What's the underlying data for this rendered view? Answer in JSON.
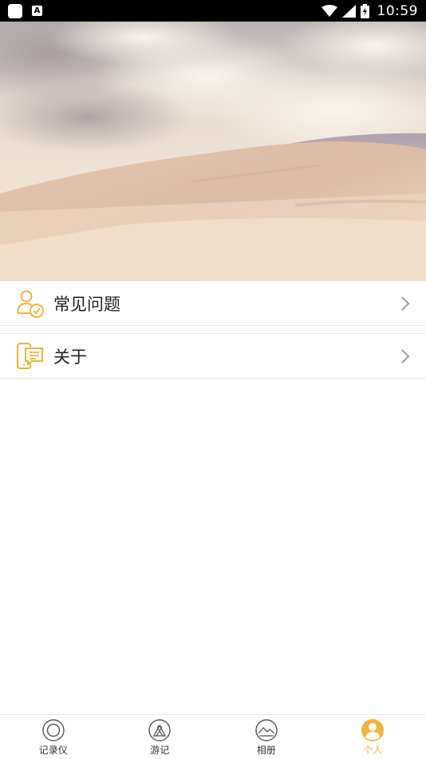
{
  "status_bar": {
    "time": "10:59",
    "notification_letter": "A"
  },
  "menu": {
    "items": [
      {
        "label": "常见问题",
        "icon": "user-check-icon"
      },
      {
        "label": "关于",
        "icon": "phone-chat-icon"
      }
    ]
  },
  "bottom_nav": {
    "items": [
      {
        "label": "记录仪",
        "icon": "record-icon",
        "active": false
      },
      {
        "label": "游记",
        "icon": "travel-icon",
        "active": false
      },
      {
        "label": "相册",
        "icon": "album-icon",
        "active": false
      },
      {
        "label": "个人",
        "icon": "person-icon",
        "active": true
      }
    ]
  },
  "colors": {
    "accent": "#f0b43a",
    "text": "#222222",
    "divider": "#e6e6e6"
  }
}
